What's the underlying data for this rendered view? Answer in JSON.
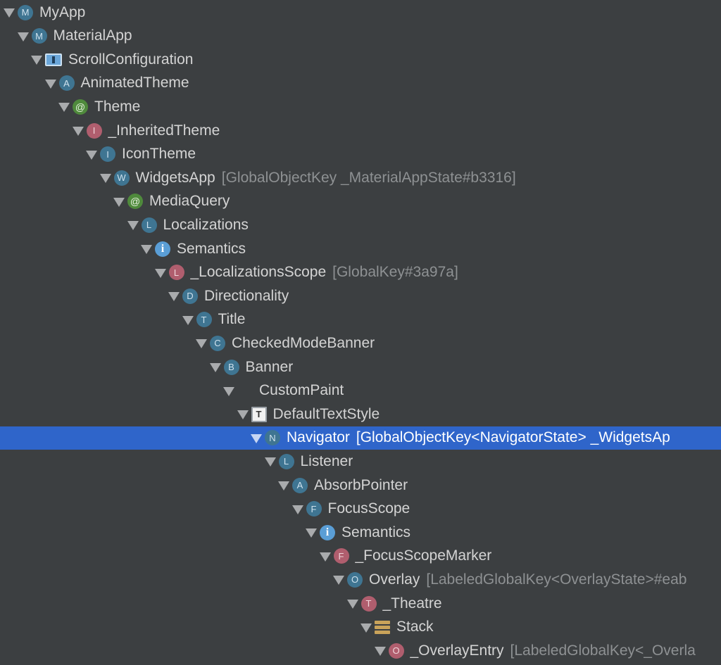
{
  "tree": {
    "rows": [
      {
        "depth": 0,
        "icon": "M",
        "icon_kind": "blue",
        "label": "MyApp",
        "key": ""
      },
      {
        "depth": 1,
        "icon": "M",
        "icon_kind": "blue",
        "label": "MaterialApp",
        "key": ""
      },
      {
        "depth": 2,
        "icon": "",
        "icon_kind": "scroll",
        "label": "ScrollConfiguration",
        "key": ""
      },
      {
        "depth": 3,
        "icon": "A",
        "icon_kind": "blue",
        "label": "AnimatedTheme",
        "key": ""
      },
      {
        "depth": 4,
        "icon": "@",
        "icon_kind": "green",
        "label": "Theme",
        "key": ""
      },
      {
        "depth": 5,
        "icon": "I",
        "icon_kind": "red",
        "label": "_InheritedTheme",
        "key": ""
      },
      {
        "depth": 6,
        "icon": "I",
        "icon_kind": "blue",
        "label": "IconTheme",
        "key": ""
      },
      {
        "depth": 7,
        "icon": "W",
        "icon_kind": "blue",
        "label": "WidgetsApp",
        "key": "[GlobalObjectKey _MaterialAppState#b3316]"
      },
      {
        "depth": 8,
        "icon": "@",
        "icon_kind": "green",
        "label": "MediaQuery",
        "key": ""
      },
      {
        "depth": 9,
        "icon": "L",
        "icon_kind": "blue",
        "label": "Localizations",
        "key": ""
      },
      {
        "depth": 10,
        "icon": "i",
        "icon_kind": "info",
        "label": "Semantics",
        "key": ""
      },
      {
        "depth": 11,
        "icon": "L",
        "icon_kind": "red",
        "label": "_LocalizationsScope",
        "key": "[GlobalKey#3a97a]"
      },
      {
        "depth": 12,
        "icon": "D",
        "icon_kind": "blue",
        "label": "Directionality",
        "key": ""
      },
      {
        "depth": 13,
        "icon": "T",
        "icon_kind": "blue",
        "label": "Title",
        "key": ""
      },
      {
        "depth": 14,
        "icon": "C",
        "icon_kind": "blue",
        "label": "CheckedModeBanner",
        "key": ""
      },
      {
        "depth": 15,
        "icon": "B",
        "icon_kind": "blue",
        "label": "Banner",
        "key": ""
      },
      {
        "depth": 16,
        "icon": "",
        "icon_kind": "paint",
        "label": "CustomPaint",
        "key": ""
      },
      {
        "depth": 17,
        "icon": "T",
        "icon_kind": "textstyle",
        "label": "DefaultTextStyle",
        "key": ""
      },
      {
        "depth": 18,
        "icon": "N",
        "icon_kind": "blue",
        "label": "Navigator",
        "key": "[GlobalObjectKey<NavigatorState> _WidgetsAp",
        "selected": true
      },
      {
        "depth": 19,
        "icon": "L",
        "icon_kind": "blue",
        "label": "Listener",
        "key": ""
      },
      {
        "depth": 20,
        "icon": "A",
        "icon_kind": "blue",
        "label": "AbsorbPointer",
        "key": ""
      },
      {
        "depth": 21,
        "icon": "F",
        "icon_kind": "blue",
        "label": "FocusScope",
        "key": ""
      },
      {
        "depth": 22,
        "icon": "i",
        "icon_kind": "info",
        "label": "Semantics",
        "key": ""
      },
      {
        "depth": 23,
        "icon": "F",
        "icon_kind": "red",
        "label": "_FocusScopeMarker",
        "key": ""
      },
      {
        "depth": 24,
        "icon": "O",
        "icon_kind": "blue",
        "label": "Overlay",
        "key": "[LabeledGlobalKey<OverlayState>#eab"
      },
      {
        "depth": 25,
        "icon": "T",
        "icon_kind": "red",
        "label": "_Theatre",
        "key": ""
      },
      {
        "depth": 26,
        "icon": "",
        "icon_kind": "stack",
        "label": "Stack",
        "key": ""
      },
      {
        "depth": 27,
        "icon": "O",
        "icon_kind": "red",
        "label": "_OverlayEntry",
        "key": "[LabeledGlobalKey<_Overla"
      }
    ]
  },
  "colors": {
    "background": "#3c3f41",
    "selection": "#2f65ca",
    "text": "#d4d4d4",
    "key_text": "#8e9193",
    "icon_blue": "#3f7592",
    "icon_red": "#b05e6e",
    "icon_green": "#4f8a3c"
  }
}
